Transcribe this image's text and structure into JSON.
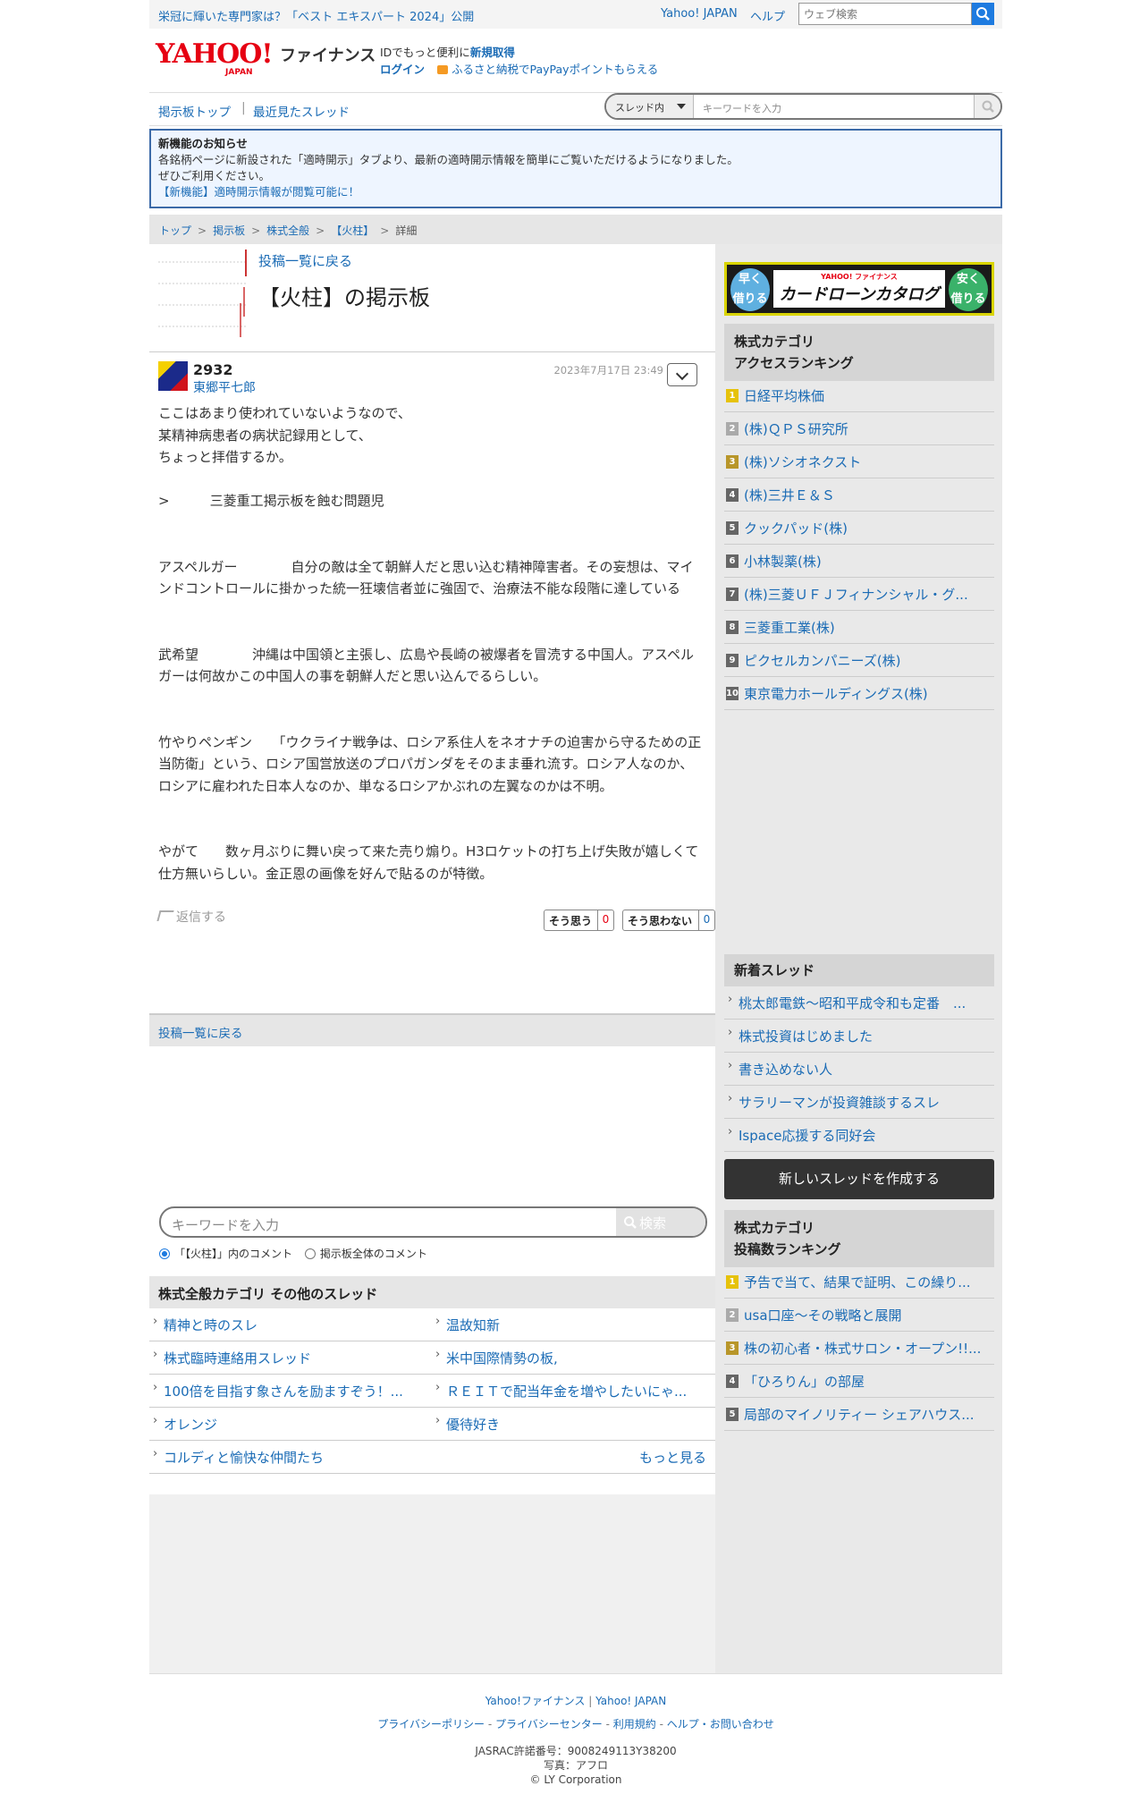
{
  "topbar": {
    "promo": "栄冠に輝いた専門家は？「ベスト エキスパート 2024」公開",
    "links": [
      "Yahoo! JAPAN",
      "ヘルプ"
    ],
    "search_placeholder": "ウェブ検索"
  },
  "header": {
    "logo_text": "YAHOO!",
    "logo_sub": "JAPAN",
    "service": "ファイナンス",
    "line1_prefix": "IDでもっと便利に",
    "line1_link": "新規取得",
    "login": "ログイン",
    "furusato": "ふるさと納税でPayPayポイントもらえる"
  },
  "nav": {
    "board_top": "掲示板トップ",
    "separator": "|",
    "recent": "最近見たスレッド",
    "scope": "スレッド内",
    "keyword_placeholder": "キーワードを入力"
  },
  "notice": {
    "title": "新機能のお知らせ",
    "line1": "各銘柄ページに新設された「適時開示」タブより、最新の適時開示情報を簡単にご覧いただけるようになりました。",
    "line2": "ぜひご利用ください。",
    "link": "【新機能】適時開示情報が閲覧可能に！"
  },
  "breadcrumb": {
    "items": [
      "トップ",
      "掲示板",
      "株式全般",
      "【火柱】",
      "詳細"
    ],
    "sep": ">"
  },
  "board": {
    "back_label": "投稿一覧に戻る",
    "title": "【火柱】の掲示板"
  },
  "post": {
    "number": "2932",
    "user": "東郷平七郎",
    "date": "2023年7月17日 23:49",
    "body": "ここはあまり使われていないようなので、\n某精神病患者の病状記録用として、\nちょっと拝借するか。\n\n>　　　三菱重工掲示板を蝕む問題児\n\n\nアスペルガー　　　　自分の敵は全て朝鮮人だと思い込む精神障害者。その妄想は、マインドコントロールに掛かった統一狂壊信者並に強固で、治療法不能な段階に達している\n\n\n武希望　　　　沖縄は中国領と主張し、広島や長崎の被爆者を冒涜する中国人。アスペルガーは何故かこの中国人の事を朝鮮人だと思い込んでるらしい。\n\n\n竹やりペンギン　　「ウクライナ戦争は、ロシア系住人をネオナチの迫害から守るための正当防衛」という、ロシア国営放送のプロパガンダをそのまま垂れ流す。ロシア人なのか、ロシアに雇われた日本人なのか、単なるロシアかぶれの左翼なのかは不明。\n\n\nやがて　　数ヶ月ぶりに舞い戻って来た売り煽り。H3ロケットの打ち上げ失敗が嬉しくて仕方無いらしい。金正恩の画像を好んで貼るのが特徴。",
    "reply": "返信する",
    "agree_label": "そう思う",
    "agree_count": "0",
    "disagree_label": "そう思わない",
    "disagree_count": "0"
  },
  "back_bottom": "投稿一覧に戻る",
  "bottom_search": {
    "placeholder": "キーワードを入力",
    "button": "検索",
    "opt1": "「【火柱】」内のコメント",
    "opt2": "掲示板全体のコメント"
  },
  "other_threads": {
    "title": "株式全般カテゴリ その他のスレッド",
    "items": [
      "精神と時のスレ",
      "温故知新",
      "株式臨時連絡用スレッド",
      "米中国際情勢の板,",
      "100倍を目指す象さんを励ますぞう！...",
      "ＲＥＩＴで配当年金を増やしたいにゃ...",
      "オレンジ",
      "優待好き",
      "コルディと愉快な仲間たち"
    ],
    "more": "もっと見る"
  },
  "banner": {
    "left": "早く借りる",
    "left_l1": "早く",
    "left_l2": "借りる",
    "right_l1": "安く",
    "right_l2": "借りる",
    "brand": "YAHOO! ファイナンス",
    "title": "カードローンカタログ"
  },
  "access_ranking": {
    "title_l1": "株式カテゴリ",
    "title_l2": "アクセスランキング",
    "items": [
      "日経平均株価",
      "(株)ＱＰＳ研究所",
      "(株)ソシオネクスト",
      "(株)三井Ｅ＆Ｓ",
      "クックパッド(株)",
      "小林製薬(株)",
      "(株)三菱ＵＦＪフィナンシャル・グ...",
      "三菱重工業(株)",
      "ピクセルカンパニーズ(株)",
      "東京電力ホールディングス(株)"
    ]
  },
  "new_threads": {
    "title": "新着スレッド",
    "items": [
      "桃太郎電鉄〜昭和平成令和も定番　...",
      "株式投資はじめました",
      "書き込めない人",
      "サラリーマンが投資雑談するスレ",
      "Ispace応援する同好会"
    ],
    "create_button": "新しいスレッドを作成する"
  },
  "post_ranking": {
    "title_l1": "株式カテゴリ",
    "title_l2": "投稿数ランキング",
    "items": [
      "予告で当て、結果で証明、この繰り...",
      "usa口座〜その戦略と展開",
      "株の初心者・株式サロン・オープン!!...",
      "「ひろりん」の部屋",
      "局部のマイノリティー シェアハウス..."
    ]
  },
  "footer": {
    "l1": [
      "Yahoo!ファイナンス",
      "Yahoo! JAPAN"
    ],
    "l2": [
      "プライバシーポリシー",
      "プライバシーセンター",
      "利用規約",
      "ヘルプ・お問い合わせ"
    ],
    "jasrac": "JASRAC許諾番号：9008249113Y38200",
    "photo": "写真：アフロ",
    "copyright": "© LY Corporation"
  },
  "colors": {
    "link": "#1a6bb5",
    "brand_red": "#e60012",
    "search_blue": "#1e7be0"
  }
}
